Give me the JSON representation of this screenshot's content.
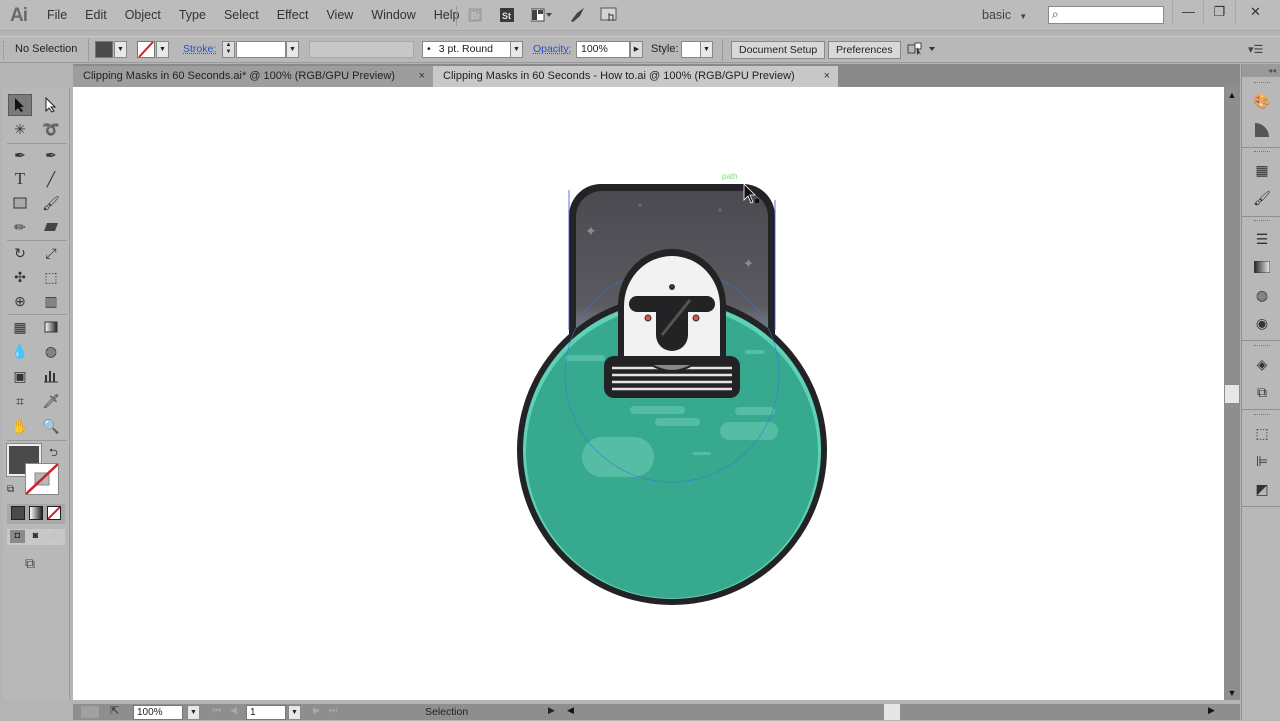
{
  "app": {
    "logo": "Ai"
  },
  "menu": [
    "File",
    "Edit",
    "Object",
    "Type",
    "Select",
    "Effect",
    "View",
    "Window",
    "Help"
  ],
  "menubar_icons": [
    "bridge-icon",
    "stock-icon",
    "arrange-documents-icon",
    "gpu-performance-icon",
    "touch-workspace-icon"
  ],
  "workspace": {
    "label": "basic"
  },
  "search": {
    "placeholder": ""
  },
  "window_controls": {
    "minimize": "—",
    "restore": "❐",
    "close": "✕"
  },
  "control_bar": {
    "selection_label": "No Selection",
    "stroke_label": "Stroke:",
    "stroke_weight": "",
    "brush": "3 pt. Round",
    "brush_dot": "•",
    "opacity_label": "Opacity:",
    "opacity_value": "100%",
    "style_label": "Style:",
    "document_setup": "Document Setup",
    "preferences": "Preferences"
  },
  "tabs": [
    {
      "label": "Clipping Masks in 60 Seconds.ai* @ 100% (RGB/GPU Preview)",
      "active": false
    },
    {
      "label": "Clipping Masks in 60 Seconds - How to.ai @ 100% (RGB/GPU Preview)",
      "active": true
    }
  ],
  "tab_close": "×",
  "canvas": {
    "smart_guide_label": "path",
    "colors": {
      "planet": "#37a98e",
      "planet_rim": "#5fd1b6",
      "outline": "#232326",
      "sky": "#4a4a50",
      "helmet": "#f2f2f2",
      "accent_eye": "#d9534f"
    }
  },
  "status_bar": {
    "zoom": "100%",
    "artboard": "1",
    "mode": "Selection"
  },
  "colors": {
    "fill": "#4a4a4a",
    "stroke": "none"
  }
}
